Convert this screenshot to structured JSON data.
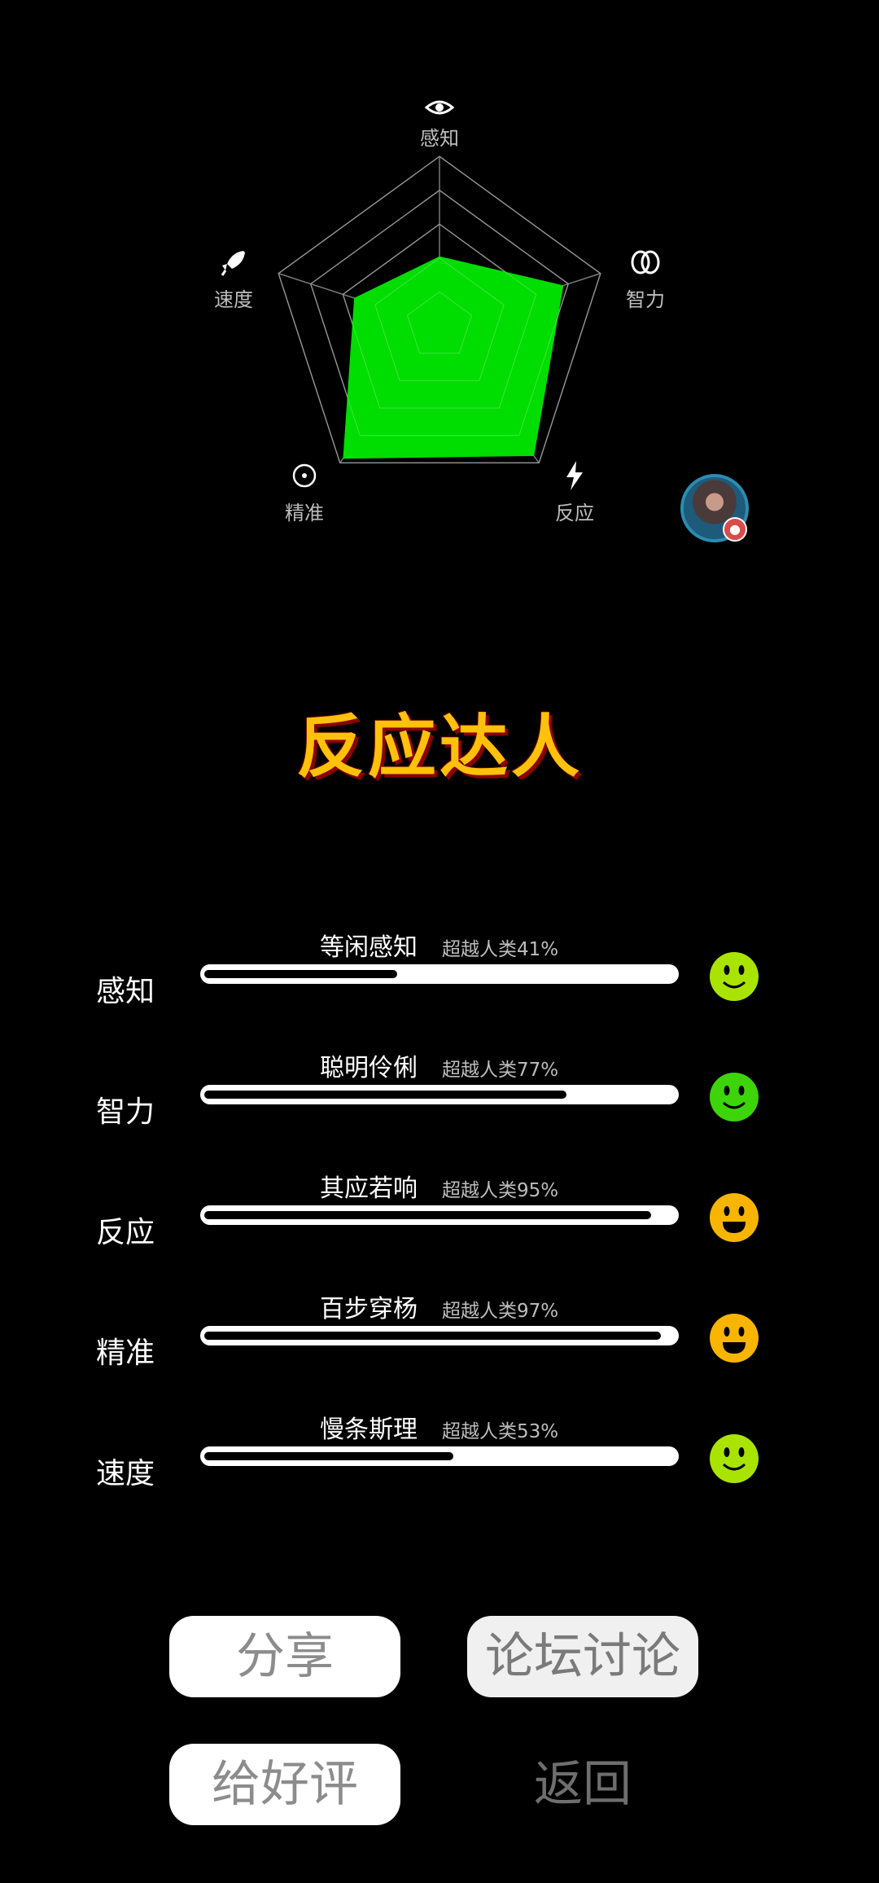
{
  "radar": {
    "axes": [
      {
        "label": "感知",
        "icon": "eye-icon",
        "value": 0.41
      },
      {
        "label": "智力",
        "icon": "brain-icon",
        "value": 0.77
      },
      {
        "label": "反应",
        "icon": "lightning-icon",
        "value": 0.95
      },
      {
        "label": "精准",
        "icon": "target-icon",
        "value": 0.97
      },
      {
        "label": "速度",
        "icon": "rocket-icon",
        "value": 0.53
      }
    ],
    "fill_color": "#00dd00"
  },
  "title": "反应达人",
  "stats": [
    {
      "label": "感知",
      "desc": "等闲感知",
      "pct_text": "超越人类41%",
      "value": 41,
      "face": "smile",
      "face_color": "#a8e400"
    },
    {
      "label": "智力",
      "desc": "聪明伶俐",
      "pct_text": "超越人类77%",
      "value": 77,
      "face": "smile",
      "face_color": "#3ed40a"
    },
    {
      "label": "反应",
      "desc": "其应若响",
      "pct_text": "超越人类95%",
      "value": 95,
      "face": "grin",
      "face_color": "#f7b500"
    },
    {
      "label": "精准",
      "desc": "百步穿杨",
      "pct_text": "超越人类97%",
      "value": 97,
      "face": "grin",
      "face_color": "#f7b500"
    },
    {
      "label": "速度",
      "desc": "慢条斯理",
      "pct_text": "超越人类53%",
      "value": 53,
      "face": "smile",
      "face_color": "#a8e400"
    }
  ],
  "buttons": {
    "share": "分享",
    "forum": "论坛讨论",
    "rate": "给好评",
    "back": "返回"
  }
}
